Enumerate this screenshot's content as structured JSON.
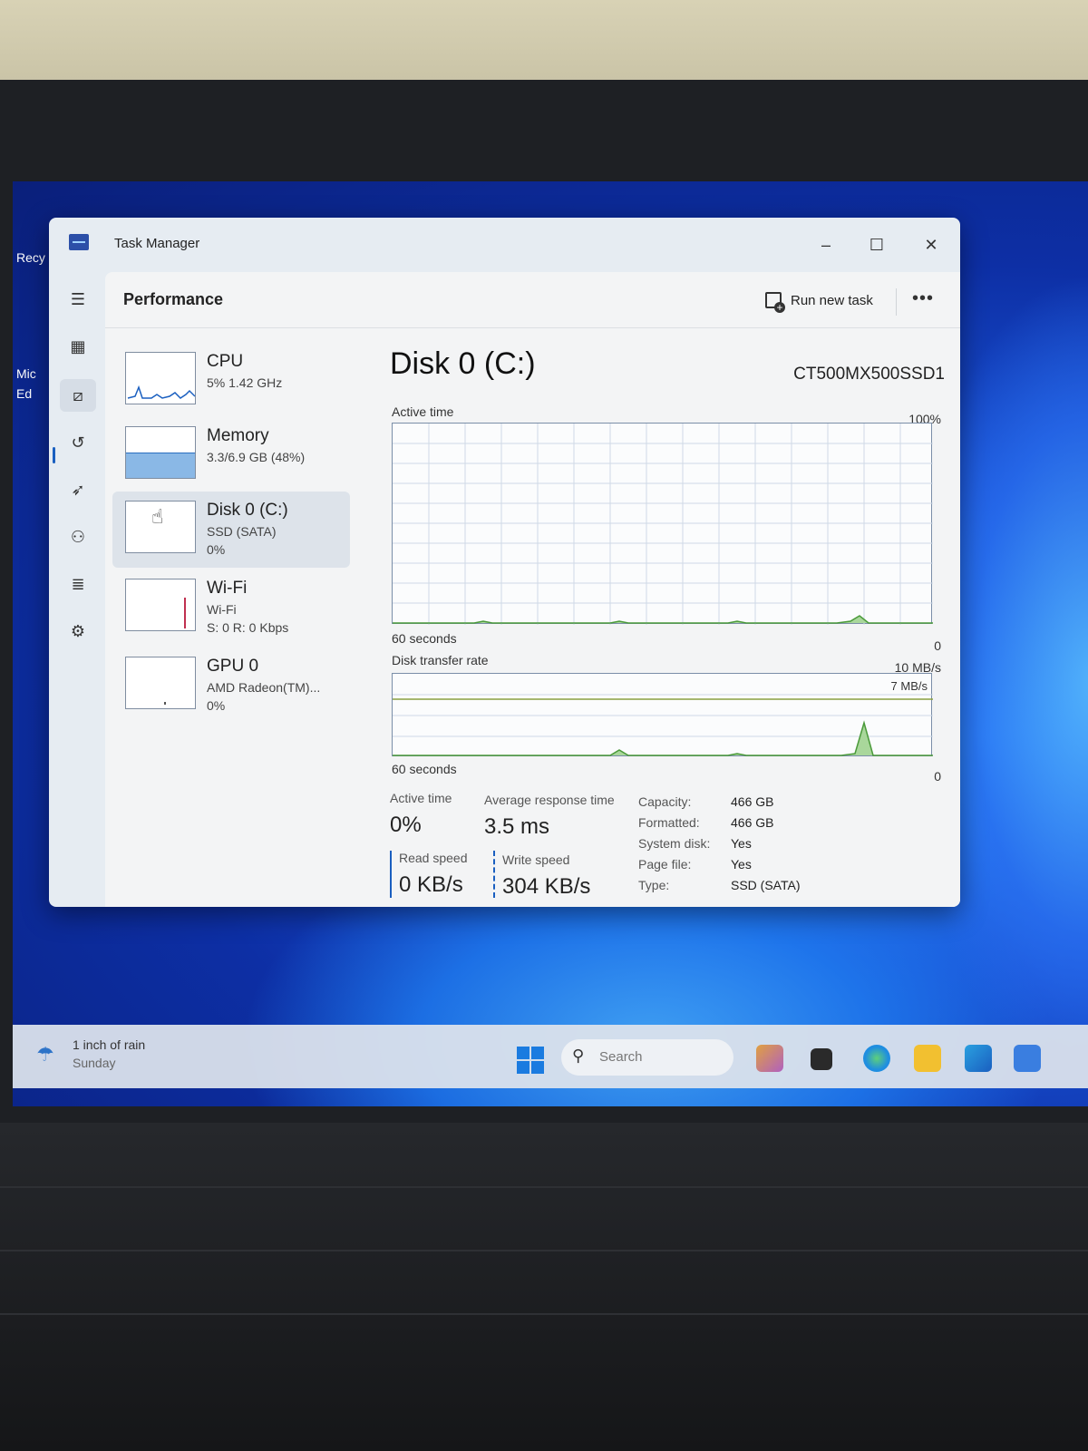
{
  "desktop": {
    "icons": [
      {
        "label": "Recy"
      },
      {
        "label": "Mic"
      },
      {
        "label": "Ed"
      }
    ]
  },
  "window": {
    "title": "Task Manager",
    "controls": {
      "minimize": "–",
      "maximize": "☐",
      "close": "✕"
    }
  },
  "nav": {
    "icons": [
      "hamburger-icon",
      "processes-icon",
      "performance-icon",
      "app-history-icon",
      "startup-apps-icon",
      "users-icon",
      "details-icon",
      "services-icon",
      "settings-icon"
    ],
    "active": "performance-icon"
  },
  "header": {
    "page_title": "Performance",
    "run_new_task": "Run new task",
    "more": "•••"
  },
  "resources": [
    {
      "name": "CPU",
      "sub": "5% 1.42 GHz",
      "sub2": "",
      "selected": false
    },
    {
      "name": "Memory",
      "sub": "3.3/6.9 GB (48%)",
      "sub2": "",
      "selected": false
    },
    {
      "name": "Disk 0 (C:)",
      "sub": "SSD (SATA)",
      "sub2": "0%",
      "selected": true
    },
    {
      "name": "Wi-Fi",
      "sub": "Wi-Fi",
      "sub2": "S: 0 R: 0 Kbps",
      "selected": false
    },
    {
      "name": "GPU 0",
      "sub": "AMD Radeon(TM)...",
      "sub2": "0%",
      "selected": false
    }
  ],
  "disk": {
    "title": "Disk 0 (C:)",
    "model": "CT500MX500SSD1",
    "active_time_graph": {
      "label": "Active time",
      "max_label": "100%",
      "time_label": "60 seconds",
      "min_label": "0"
    },
    "transfer_graph": {
      "label": "Disk transfer rate",
      "max_label": "10 MB/s",
      "ref_label": "7 MB/s",
      "time_label": "60 seconds",
      "min_label": "0"
    },
    "stats": {
      "active_time_label": "Active time",
      "active_time_value": "0%",
      "avg_response_label": "Average response time",
      "avg_response_value": "3.5 ms",
      "read_speed_label": "Read speed",
      "read_speed_value": "0 KB/s",
      "write_speed_label": "Write speed",
      "write_speed_value": "304 KB/s"
    },
    "properties": [
      {
        "key": "Capacity:",
        "value": "466 GB"
      },
      {
        "key": "Formatted:",
        "value": "466 GB"
      },
      {
        "key": "System disk:",
        "value": "Yes"
      },
      {
        "key": "Page file:",
        "value": "Yes"
      },
      {
        "key": "Type:",
        "value": "SSD (SATA)"
      }
    ]
  },
  "taskbar": {
    "weather_line1": "1 inch of rain",
    "weather_line2": "Sunday",
    "search_placeholder": "Search"
  },
  "colors": {
    "accent": "#1a5fc0",
    "disk_graph_line": "#4a9a3a",
    "memory_fill": "#8ab8e6",
    "wifi_line": "#c03050"
  }
}
